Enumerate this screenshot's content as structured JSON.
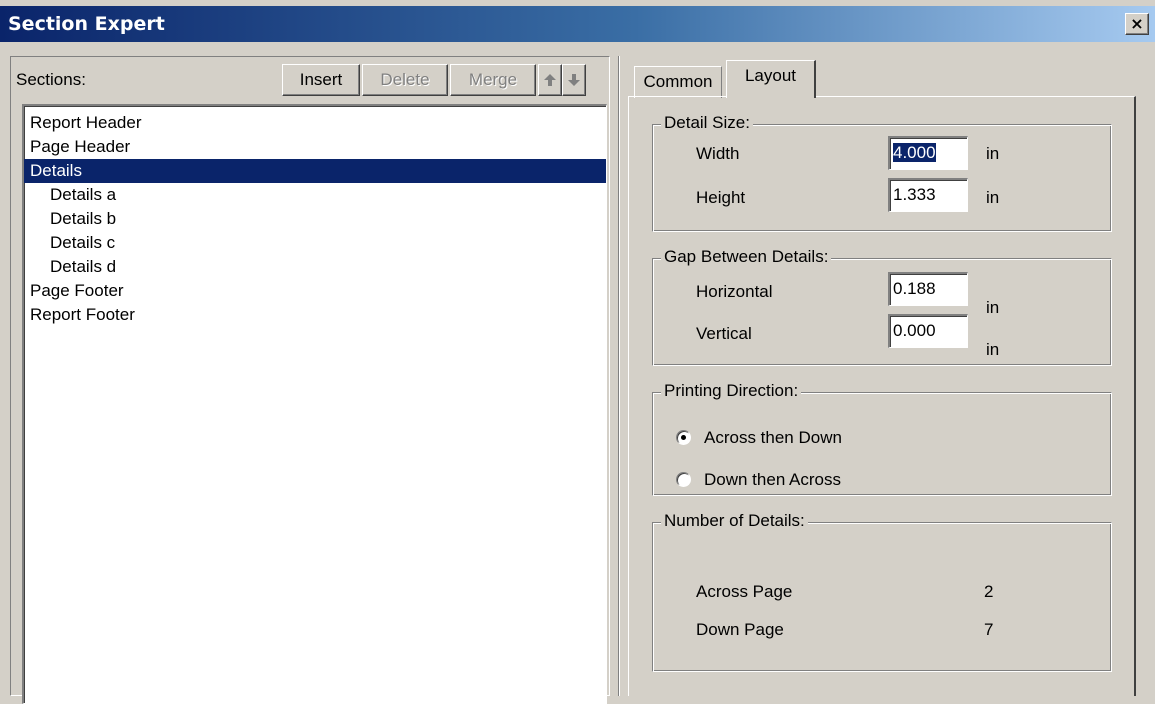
{
  "window": {
    "title": "Section Expert",
    "close_glyph": "×"
  },
  "sections_panel": {
    "label": "Sections:",
    "buttons": {
      "insert": "Insert",
      "delete": "Delete",
      "merge": "Merge",
      "up_icon": "up-arrow-icon",
      "down_icon": "down-arrow-icon"
    },
    "items": [
      {
        "label": "Report Header"
      },
      {
        "label": "Page Header"
      },
      {
        "label": "Details"
      },
      {
        "label": "Details a"
      },
      {
        "label": "Details b"
      },
      {
        "label": "Details c"
      },
      {
        "label": "Details d"
      },
      {
        "label": "Page Footer"
      },
      {
        "label": "Report Footer"
      }
    ],
    "selected": "Details"
  },
  "tabs": [
    {
      "label": "Common"
    },
    {
      "label": "Layout"
    }
  ],
  "active_tab": "Layout",
  "detail_size": {
    "label": "Detail Size:",
    "width_label": "Width",
    "width_value": "4.000",
    "width_unit": "in",
    "height_label": "Height",
    "height_value": "1.333",
    "height_unit": "in"
  },
  "gap": {
    "label": "Gap Between Details:",
    "horizontal_label": "Horizontal",
    "horizontal_value": "0.188",
    "horizontal_unit": "in",
    "vertical_label": "Vertical",
    "vertical_value": "0.000",
    "vertical_unit": "in"
  },
  "printing_direction": {
    "label": "Printing Direction:",
    "option1": "Across then Down",
    "option2": "Down then Across",
    "selected": "Across then Down"
  },
  "number_of_details": {
    "label": "Number of Details:",
    "across_label": "Across Page",
    "across_value": "2",
    "down_label": "Down Page",
    "down_value": "7"
  },
  "colors": {
    "selection": "#0a246a",
    "face": "#d4d0c8",
    "title_start": "#0a246a",
    "title_end": "#a6caf0"
  }
}
